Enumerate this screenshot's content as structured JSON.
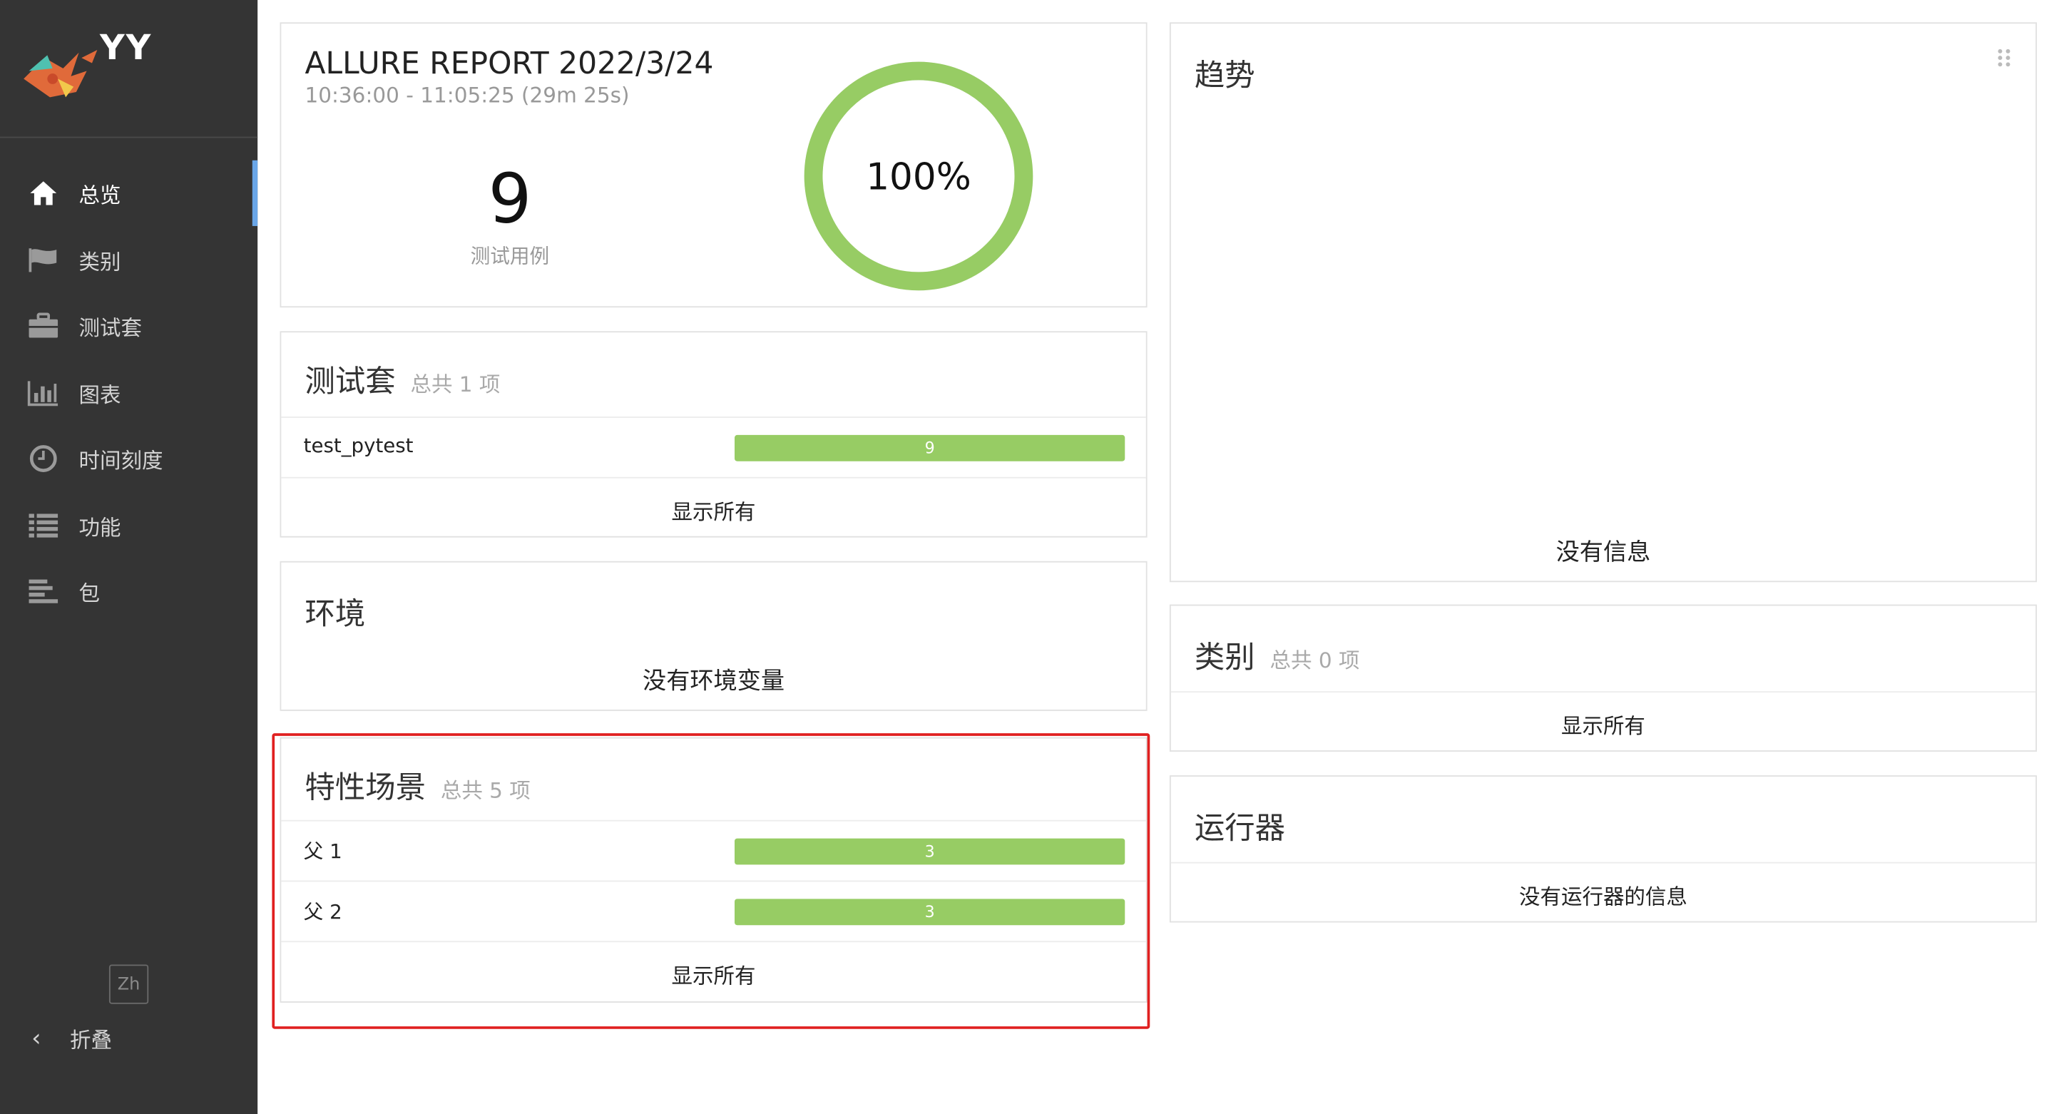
{
  "sidebar": {
    "brand": "YY",
    "items": [
      {
        "label": "总览",
        "icon": "home-icon",
        "active": true
      },
      {
        "label": "类别",
        "icon": "flag-icon",
        "active": false
      },
      {
        "label": "测试套",
        "icon": "briefcase-icon",
        "active": false
      },
      {
        "label": "图表",
        "icon": "bar-chart-icon",
        "active": false
      },
      {
        "label": "时间刻度",
        "icon": "clock-icon",
        "active": false
      },
      {
        "label": "功能",
        "icon": "list-icon",
        "active": false
      },
      {
        "label": "包",
        "icon": "align-left-icon",
        "active": false
      }
    ],
    "lang": "Zh",
    "collapse_label": "折叠"
  },
  "summary": {
    "title": "ALLURE REPORT 2022/3/24",
    "time_range": "10:36:00 - 11:05:25 (29m 25s)",
    "test_count": "9",
    "test_count_label": "测试用例",
    "pass_percent": "100%",
    "pass_fraction": 1.0
  },
  "suites": {
    "title": "测试套",
    "count": "总共 1 项",
    "rows": [
      {
        "label": "test_pytest",
        "value": "9"
      }
    ],
    "show_all": "显示所有"
  },
  "environment": {
    "title": "环境",
    "empty": "没有环境变量"
  },
  "features": {
    "title": "特性场景",
    "count": "总共 5 项",
    "rows": [
      {
        "label": "父 1",
        "value": "3"
      },
      {
        "label": "父 2",
        "value": "3"
      }
    ],
    "show_all": "显示所有"
  },
  "trend": {
    "title": "趋势",
    "empty": "没有信息",
    "drag_icon": "drag-handle-icon"
  },
  "categories": {
    "title": "类别",
    "count": "总共 0 项",
    "show_all": "显示所有"
  },
  "executors": {
    "title": "运行器",
    "empty": "没有运行器的信息"
  },
  "colors": {
    "sidebar_bg": "#343434",
    "accent": "#6aa6e8",
    "passed": "#97cc64",
    "highlight": "#e02020"
  }
}
